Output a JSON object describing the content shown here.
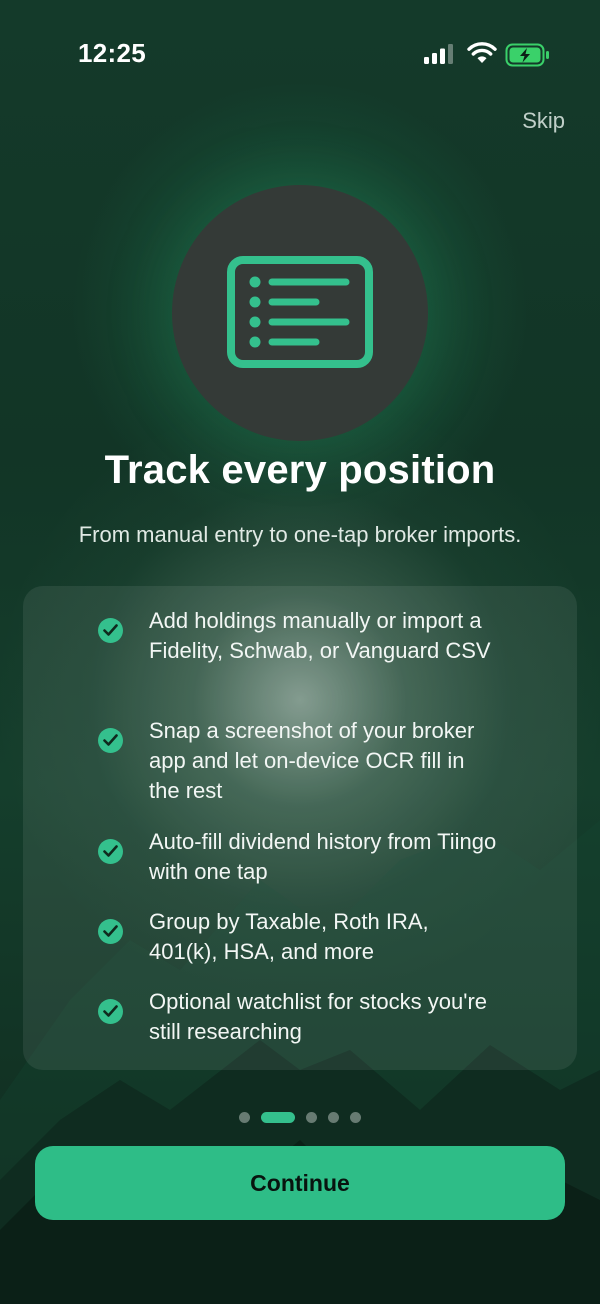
{
  "status_bar": {
    "time": "12:25",
    "icons": [
      "signal-icon",
      "wifi-icon",
      "battery-charging-icon"
    ]
  },
  "header": {
    "skip_label": "Skip"
  },
  "hero": {
    "icon": "list-icon",
    "title": "Track every position",
    "subtitle": "From manual entry to one-tap broker imports."
  },
  "features": [
    {
      "icon": "check-circle-icon",
      "text": "Add holdings manually or import a Fidelity, Schwab, or Vanguard CSV"
    },
    {
      "icon": "check-circle-icon",
      "text": "Snap a screenshot of your broker app and let on-device OCR fill in the rest"
    },
    {
      "icon": "check-circle-icon",
      "text": "Auto-fill dividend history from Tiingo with one tap"
    },
    {
      "icon": "check-circle-icon",
      "text": "Group by Taxable, Roth IRA, 401(k), HSA, and more"
    },
    {
      "icon": "check-circle-icon",
      "text": "Optional watchlist for stocks you're still researching"
    }
  ],
  "pager": {
    "total": 5,
    "active_index": 1
  },
  "footer": {
    "continue_label": "Continue"
  },
  "colors": {
    "accent": "#2ebd87",
    "check": "#34c08d",
    "background": "#133626",
    "hero_circle": "#343a37"
  }
}
